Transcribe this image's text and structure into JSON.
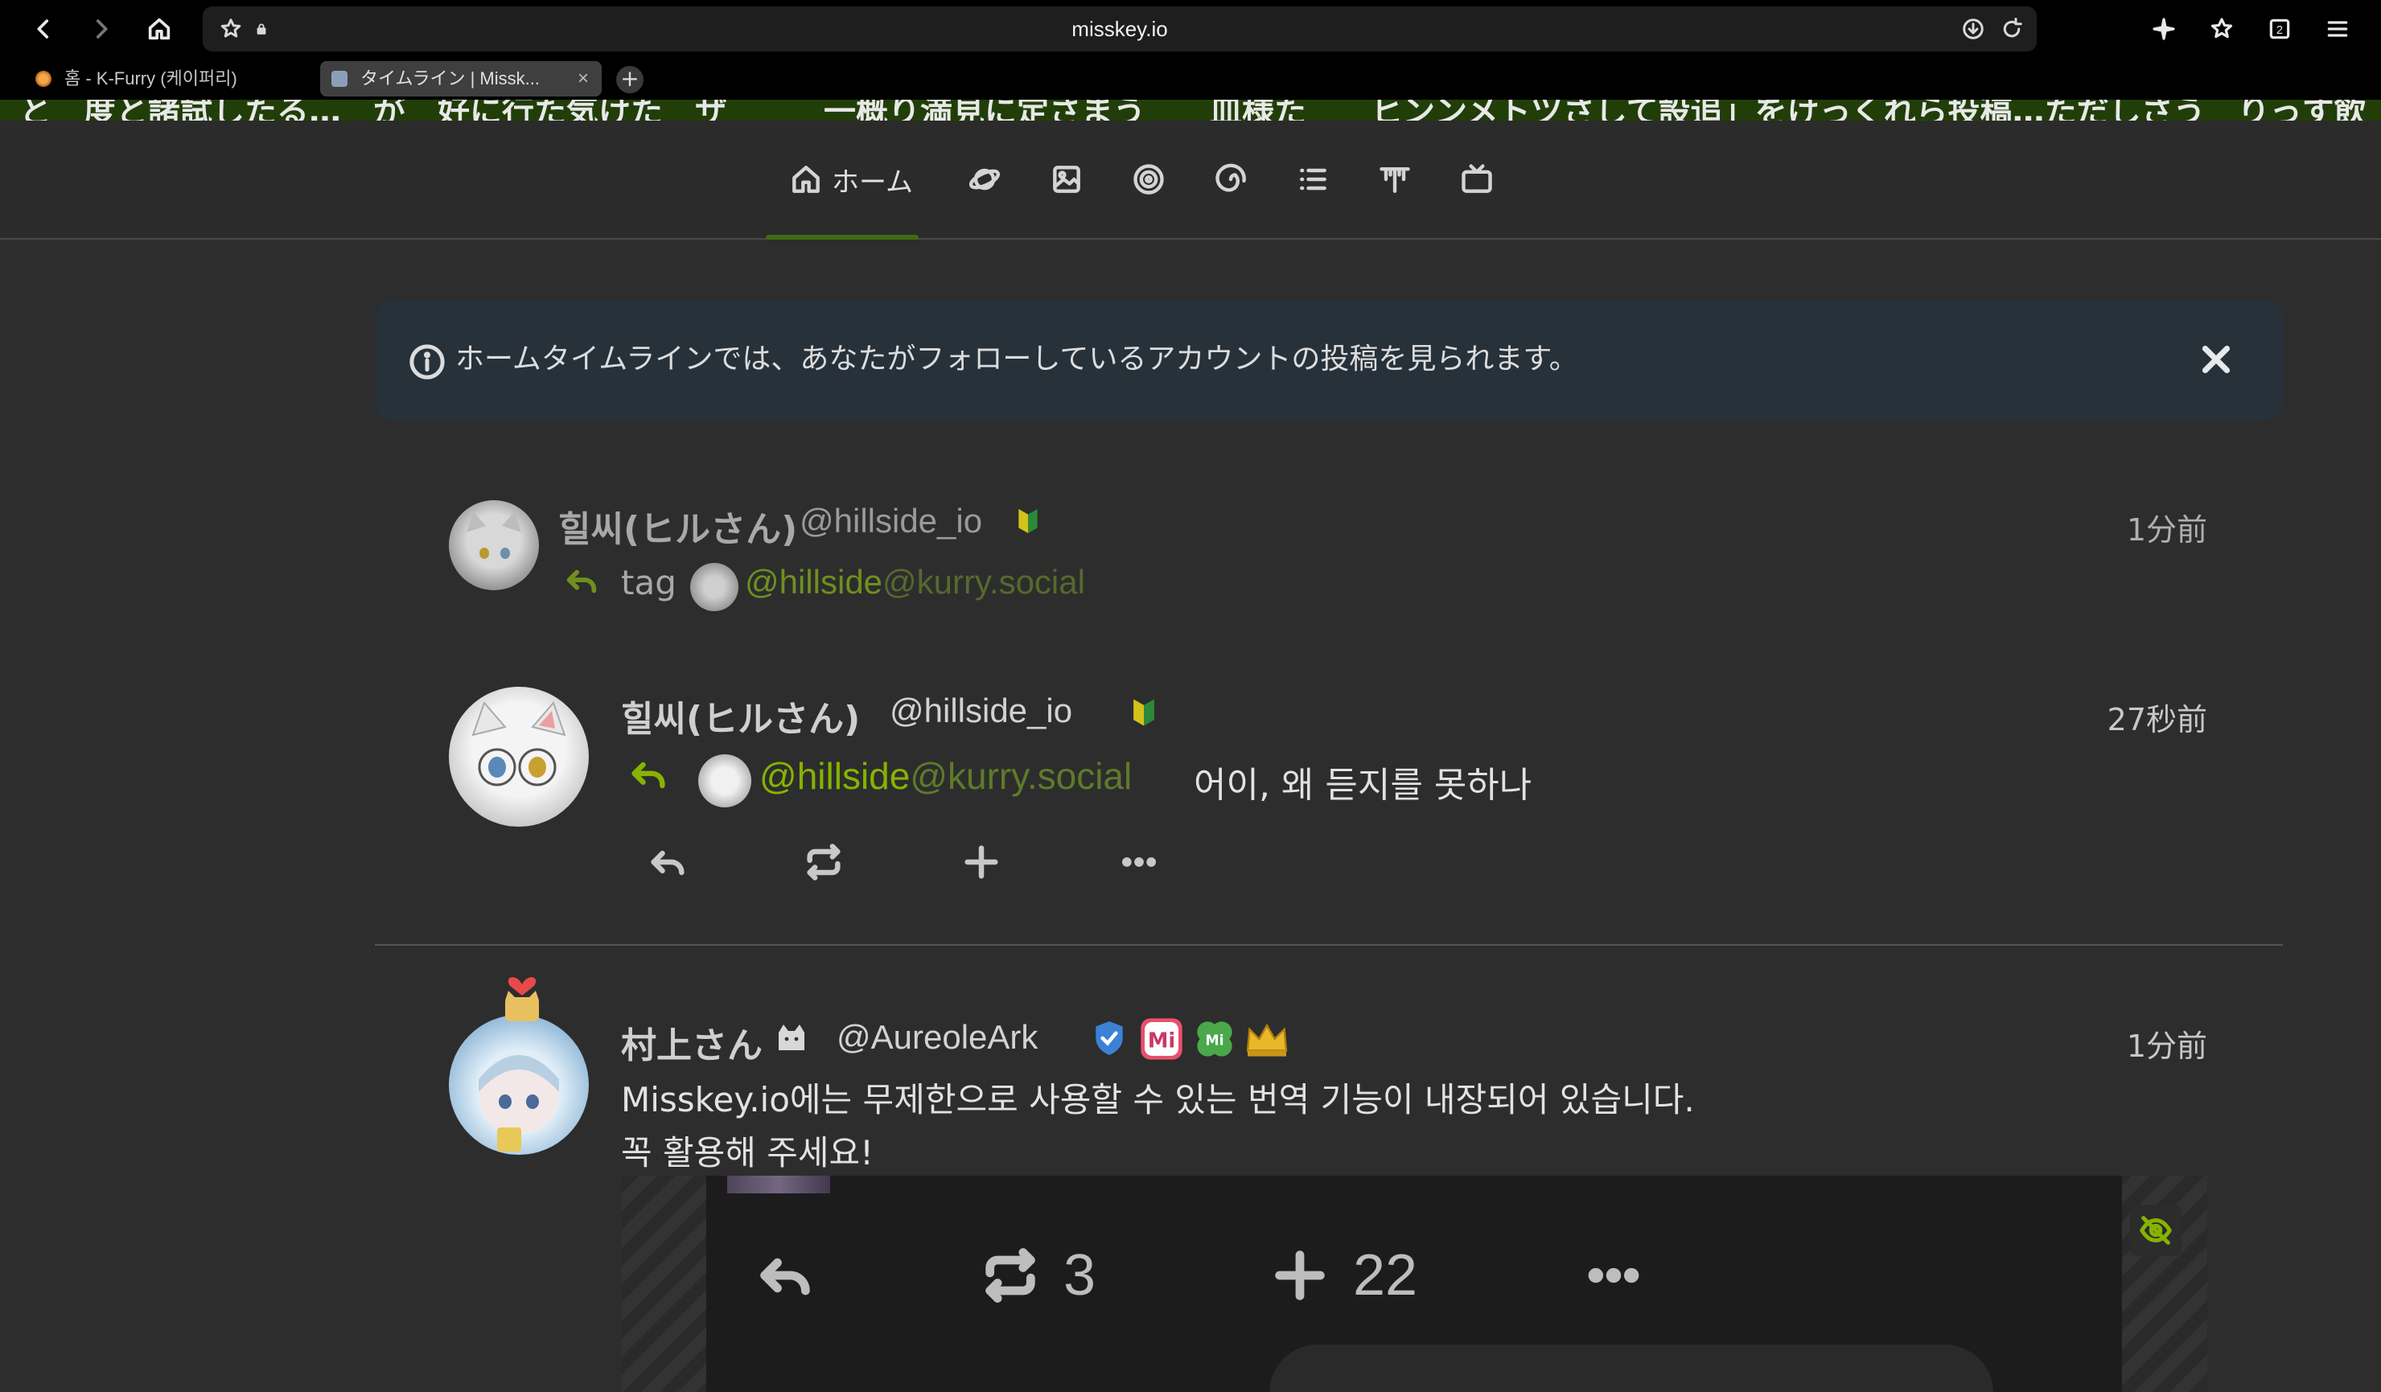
{
  "browser": {
    "url": "misskey.io",
    "tabs": [
      {
        "title": "홈 - K-Furry (케이퍼리)",
        "active": false
      },
      {
        "title": "タイムライン | Missk...",
        "active": true
      }
    ],
    "new_tab_label": "+",
    "download_icon": "download-icon",
    "reload_icon": "reload-icon"
  },
  "banner": {
    "text": "と　度と諸試したる…　が　好に行た気けた　ザ　　　一概り満見に定さまう　　皿様た　　ヒンンメトツさして設追」をけっくれら投稿…ただしさう　りっす飲　。しし"
  },
  "header": {
    "tabs": [
      {
        "label": "ホーム",
        "icon": "home-icon",
        "active": true
      },
      {
        "label": "",
        "icon": "planet-icon"
      },
      {
        "label": "",
        "icon": "image-icon"
      },
      {
        "label": "",
        "icon": "target-icon"
      },
      {
        "label": "",
        "icon": "whirl-icon"
      },
      {
        "label": "",
        "icon": "list-icon"
      },
      {
        "label": "",
        "icon": "antenna-icon"
      },
      {
        "label": "",
        "icon": "tv-icon"
      }
    ]
  },
  "info": {
    "text": "ホームタイムラインでは、あなたがフォローしているアカウントの投稿を見られます。"
  },
  "notes": [
    {
      "name": "힐씨(ヒルさん)",
      "handle": "@hillside_io",
      "time": "1分前",
      "reply_prefix": "tag",
      "mention_user": "@hillside",
      "mention_host": "@kurry.social"
    },
    {
      "name": "힐씨(ヒルさん)",
      "handle": "@hillside_io",
      "time": "27秒前",
      "mention_user": "@hillside",
      "mention_host": "@kurry.social",
      "text": "어이, 왜 듣지를 못하나"
    },
    {
      "name": "村上さん",
      "handle": "@AureoleArk",
      "time": "1分前",
      "text_line1": "Misskey.io에는 무제한으로 사용할 수 있는 번역 기능이 내장되어 있습니다.",
      "text_line2": "꼭 활용해 주세요!",
      "media": {
        "renote_count": "3",
        "reaction_count": "22"
      }
    }
  ],
  "colors": {
    "accent": "#86b300",
    "background": "#2d2d2d",
    "info_bg": "#26313a",
    "banner_bg": "#213e09"
  }
}
